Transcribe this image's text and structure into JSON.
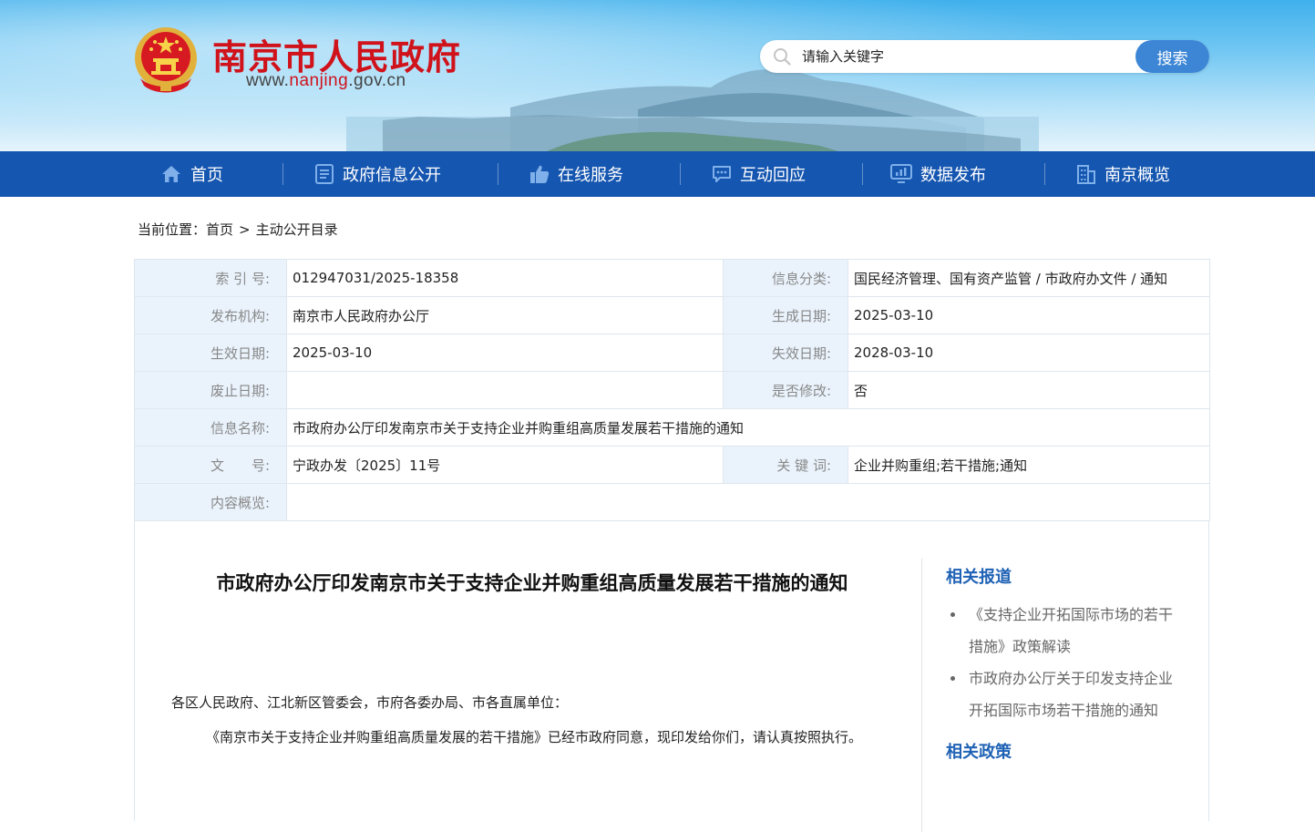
{
  "header": {
    "site_title": "南京市人民政府",
    "domain_prefix": "www.",
    "domain_highlight": "nanjing",
    "domain_suffix": ".gov.cn",
    "search_placeholder": "请输入关键字",
    "search_button": "搜索",
    "title_color": "#d0121b"
  },
  "nav": {
    "items": [
      {
        "label": "首页",
        "icon": "home-icon"
      },
      {
        "label": "政府信息公开",
        "icon": "document-icon"
      },
      {
        "label": "在线服务",
        "icon": "thumbs-up-icon"
      },
      {
        "label": "互动回应",
        "icon": "chat-icon"
      },
      {
        "label": "数据发布",
        "icon": "chart-monitor-icon"
      },
      {
        "label": "南京概览",
        "icon": "building-icon"
      }
    ],
    "background": "#1556b0"
  },
  "breadcrumb": {
    "prefix": "当前位置：",
    "home": "首页",
    "separator": ">",
    "current": "主动公开目录"
  },
  "meta": {
    "index_no_label": "索 引 号:",
    "index_no": "012947031/2025-18358",
    "category_label": "信息分类:",
    "category": "国民经济管理、国有资产监管 / 市政府办文件 / 通知",
    "publisher_label": "发布机构:",
    "publisher": "南京市人民政府办公厅",
    "created_label": "生成日期:",
    "created": "2025-03-10",
    "effective_label": "生效日期:",
    "effective": "2025-03-10",
    "expire_label": "失效日期:",
    "expire": "2028-03-10",
    "abolish_label": "废止日期:",
    "abolish": "",
    "modified_label": "是否修改:",
    "modified": "否",
    "name_label": "信息名称:",
    "name": "市政府办公厅印发南京市关于支持企业并购重组高质量发展若干措施的通知",
    "doc_no_label": "文　　号:",
    "doc_no": "宁政办发〔2025〕11号",
    "keywords_label": "关 键 词:",
    "keywords": "企业并购重组;若干措施;通知",
    "summary_label": "内容概览:",
    "summary": ""
  },
  "document": {
    "title": "市政府办公厅印发南京市关于支持企业并购重组高质量发展若干措施的通知",
    "recipients": "各区人民政府、江北新区管委会，市府各委办局、市各直属单位：",
    "body": "《南京市关于支持企业并购重组高质量发展的若干措施》已经市政府同意，现印发给你们，请认真按照执行。"
  },
  "sidebar": {
    "related_reports_title": "相关报道",
    "related_reports": [
      "《支持企业开拓国际市场的若干措施》政策解读",
      "市政府办公厅关于印发支持企业开拓国际市场若干措施的通知"
    ],
    "related_policies_title": "相关政策",
    "accent": "#1f62b5"
  }
}
